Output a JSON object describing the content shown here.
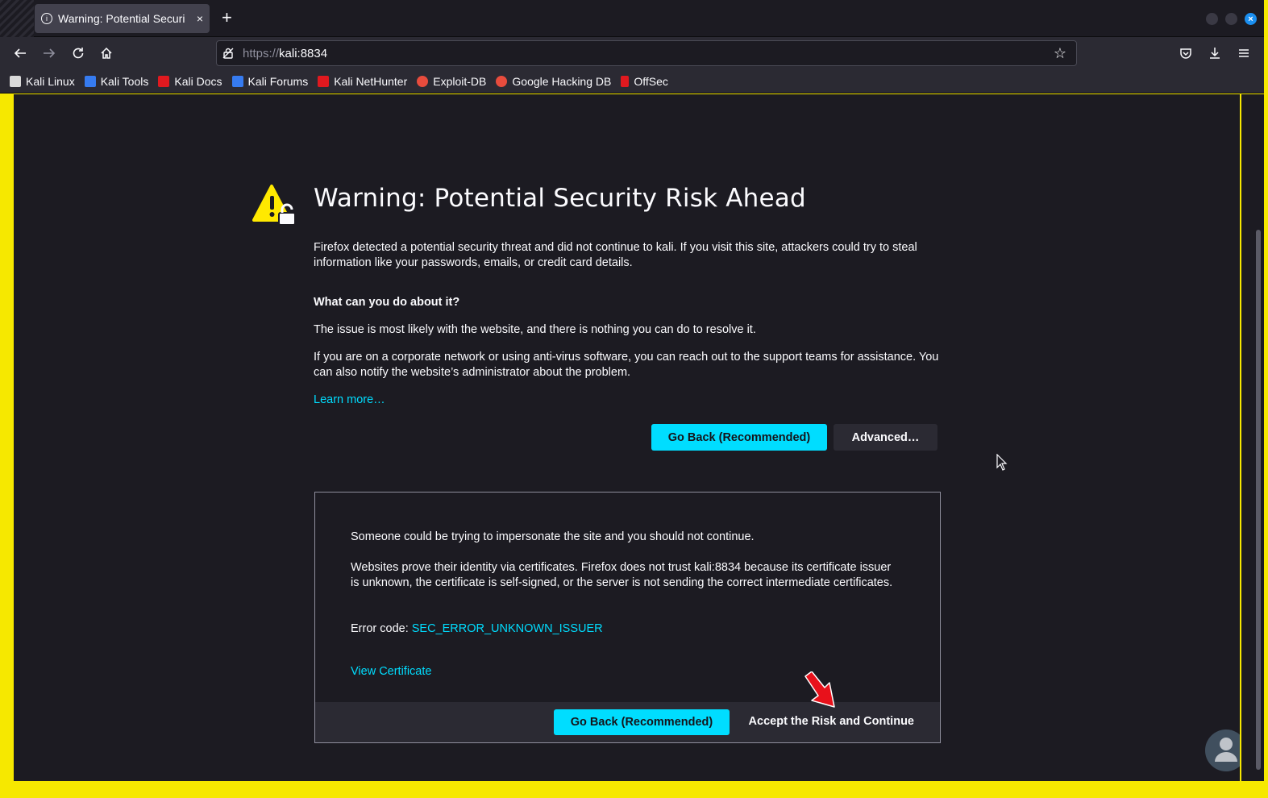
{
  "browser": {
    "tab_title": "Warning: Potential Securi",
    "tab_close": "×",
    "new_tab": "+",
    "url_scheme": "https://",
    "url_host": "kali:8834",
    "icons": {
      "back": "back-arrow-icon",
      "forward": "forward-arrow-icon",
      "reload": "reload-icon",
      "home": "home-icon",
      "star": "bookmark-star-icon",
      "pocket": "pocket-icon",
      "downloads": "download-icon",
      "menu": "hamburger-menu-icon"
    },
    "bookmarks": [
      {
        "label": "Kali Linux",
        "color": "#d9d9d9"
      },
      {
        "label": "Kali Tools",
        "color": "#367bf0"
      },
      {
        "label": "Kali Docs",
        "color": "#e0191f"
      },
      {
        "label": "Kali Forums",
        "color": "#367bf0"
      },
      {
        "label": "Kali NetHunter",
        "color": "#e0191f"
      },
      {
        "label": "Exploit-DB",
        "color": "#e84c3d"
      },
      {
        "label": "Google Hacking DB",
        "color": "#e84c3d"
      },
      {
        "label": "OffSec",
        "color": "#e0191f"
      }
    ]
  },
  "page": {
    "heading": "Warning: Potential Security Risk Ahead",
    "intro": "Firefox detected a potential security threat and did not continue to kali. If you visit this site, attackers could try to steal information like your passwords, emails, or credit card details.",
    "what_heading": "What can you do about it?",
    "issue_text": "The issue is most likely with the website, and there is nothing you can do to resolve it.",
    "corporate_text": "If you are on a corporate network or using anti-virus software, you can reach out to the support teams for assistance. You can also notify the website’s administrator about the problem.",
    "learn_more": "Learn more…",
    "go_back": "Go Back (Recommended)",
    "advanced": "Advanced…"
  },
  "advanced_panel": {
    "impersonate": "Someone could be trying to impersonate the site and you should not continue.",
    "certificates": "Websites prove their identity via certificates. Firefox does not trust kali:8834 because its certificate issuer is unknown, the certificate is self-signed, or the server is not sending the correct intermediate certificates.",
    "error_label": "Error code: ",
    "error_code": "SEC_ERROR_UNKNOWN_ISSUER",
    "view_certificate": "View Certificate",
    "go_back": "Go Back (Recommended)",
    "accept": "Accept the Risk and Continue"
  },
  "colors": {
    "accent": "#00ddff",
    "background": "#1c1b22",
    "border_highlight": "#f6e800",
    "annotation_arrow": "#e8111b"
  }
}
